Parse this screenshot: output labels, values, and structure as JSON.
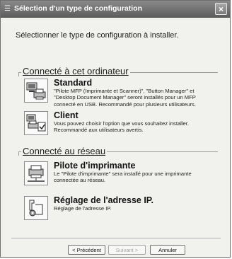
{
  "window": {
    "title": "Sélection d'un type de configuration",
    "close_label": "×"
  },
  "prompt": "Sélectionner le type de configuration à installer.",
  "sections": {
    "local": {
      "title": "Connecté à cet ordinateur",
      "standard": {
        "title": "Standard",
        "description": "\"Pilote MFP (Imprimante et Scanner)\", \"Button Manager\" et \"Desktop Document Manager\" seront installés pour un MFP connecté en USB. Recommandé pour plusieurs utilisateurs.",
        "icon": "computer-printer-icon"
      },
      "client": {
        "title": "Client",
        "description": "Vous pouvez choisir l'option que vous souhaitez installer. Recommandé aux utilisateurs avertis.",
        "icon": "computer-checklist-icon"
      }
    },
    "network": {
      "title": "Connecté au réseau",
      "printer_driver": {
        "title": "Pilote d'imprimante",
        "description": "Le \"Pilote d'imprimante\" sera installé pour une imprimante connectée au réseau.",
        "icon": "network-printer-icon"
      },
      "ip_setting": {
        "title": "Réglage de l'adresse IP.",
        "description": "Réglage de l'adresse IP.",
        "icon": "ip-gear-icon"
      }
    }
  },
  "buttons": {
    "back": "< Précédent",
    "next": "Suivant >",
    "cancel": "Annuler"
  }
}
